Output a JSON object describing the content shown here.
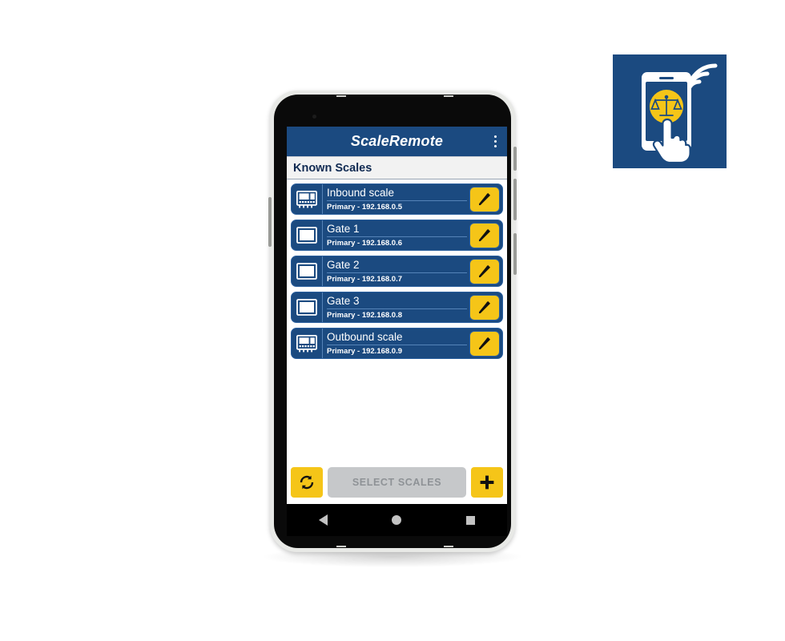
{
  "logo": {
    "name": "scaleremote-app-logo",
    "background_color": "#1b4a80",
    "accent_color": "#f5c518"
  },
  "app_bar": {
    "title": "ScaleRemote",
    "overflow_icon": "more-vertical-icon"
  },
  "section": {
    "header": "Known Scales"
  },
  "list": {
    "items": [
      {
        "icon": "scale-indicator-icon",
        "title": "Inbound scale",
        "subtitle": "Primary - 192.168.0.5",
        "edit_icon": "pencil-icon"
      },
      {
        "icon": "gate-icon",
        "title": "Gate 1",
        "subtitle": "Primary - 192.168.0.6",
        "edit_icon": "pencil-icon"
      },
      {
        "icon": "gate-icon",
        "title": "Gate 2",
        "subtitle": "Primary - 192.168.0.7",
        "edit_icon": "pencil-icon"
      },
      {
        "icon": "gate-icon",
        "title": "Gate 3",
        "subtitle": "Primary - 192.168.0.8",
        "edit_icon": "pencil-icon"
      },
      {
        "icon": "scale-indicator-icon",
        "title": "Outbound scale",
        "subtitle": "Primary - 192.168.0.9",
        "edit_icon": "pencil-icon"
      }
    ]
  },
  "toolbar": {
    "refresh_icon": "refresh-icon",
    "select_scales_label": "SELECT SCALES",
    "select_scales_enabled": false,
    "add_icon": "plus-icon"
  },
  "navigation_bar": {
    "back_icon": "triangle-back-icon",
    "home_icon": "circle-home-icon",
    "recents_icon": "square-recents-icon"
  },
  "theme": {
    "primary_blue": "#1b4a80",
    "accent_yellow": "#f5c518",
    "row_border": "#2a5f9e",
    "disabled_grey": "#c6c8ca"
  }
}
